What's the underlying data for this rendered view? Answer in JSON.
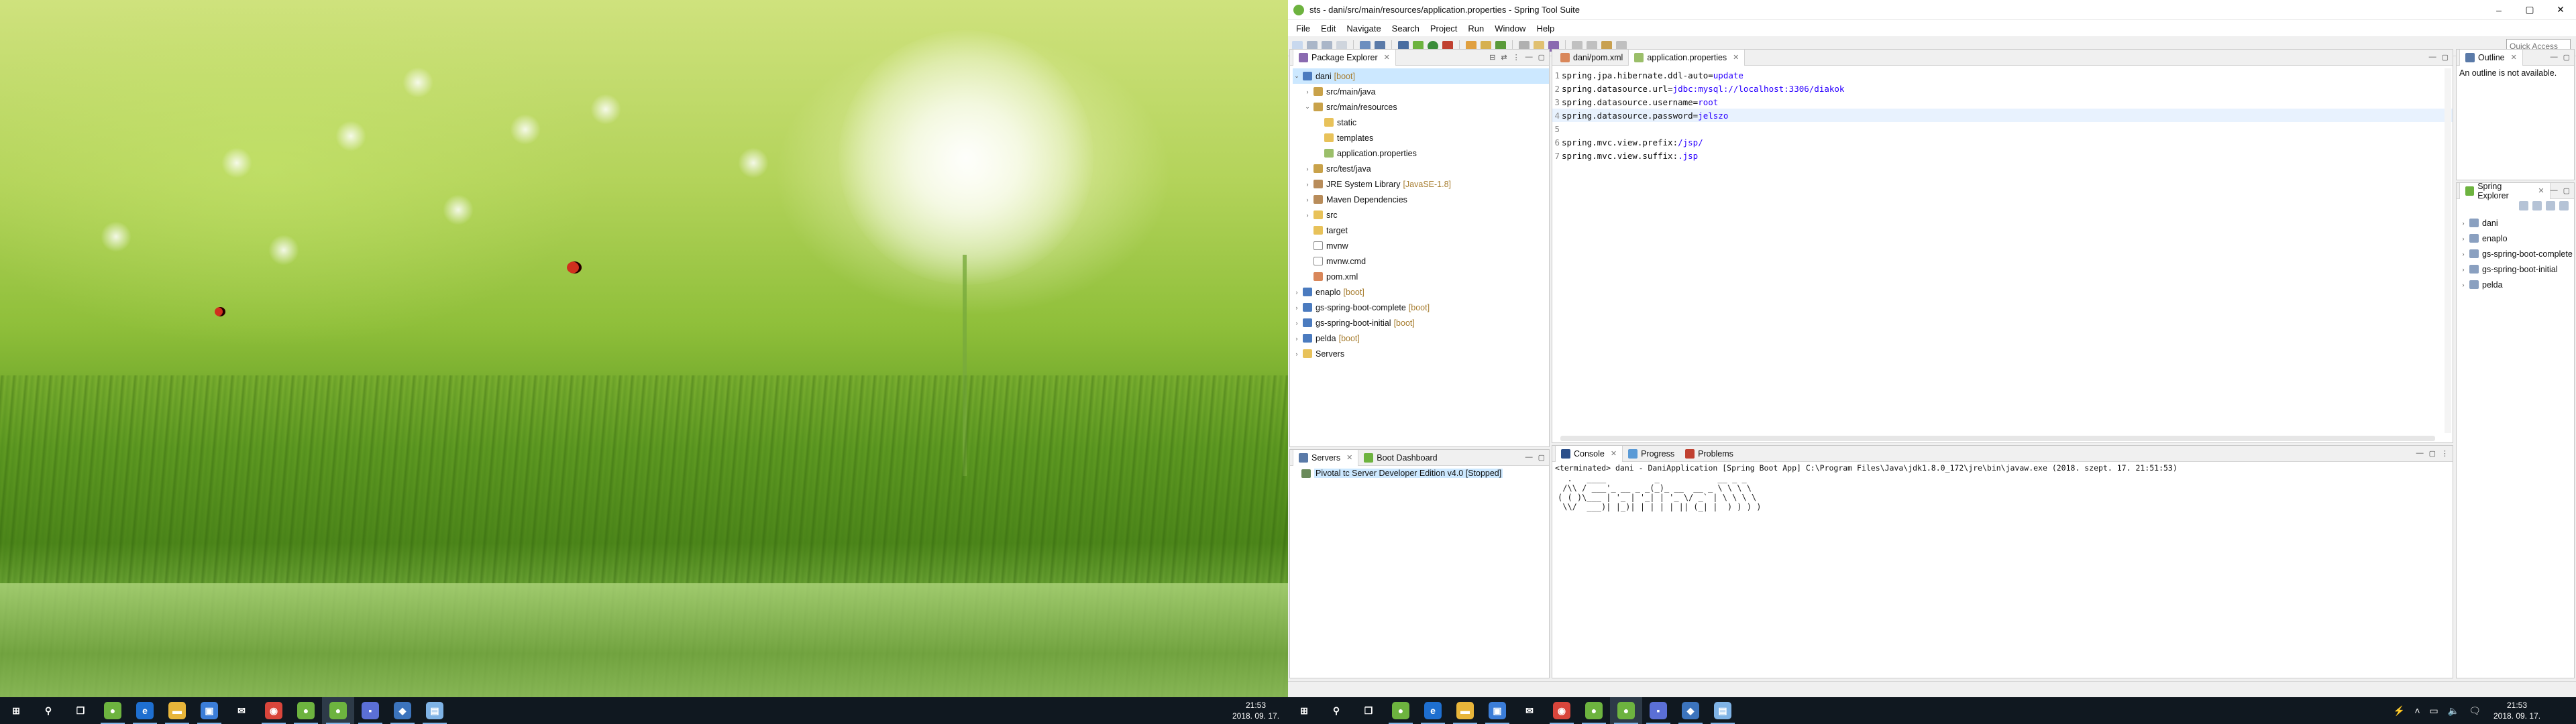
{
  "window": {
    "title": "sts - dani/src/main/resources/application.properties - Spring Tool Suite",
    "controls": [
      "–",
      "▢",
      "✕"
    ]
  },
  "menu": [
    "File",
    "Edit",
    "Navigate",
    "Search",
    "Project",
    "Run",
    "Window",
    "Help"
  ],
  "quick_access": {
    "placeholder": "Quick Access"
  },
  "package_explorer": {
    "tab_label": "Package Explorer",
    "tree": [
      {
        "label": "dani",
        "decor": "[boot]",
        "icon": "project",
        "level": 0,
        "expanded": true,
        "selected": true
      },
      {
        "label": "src/main/java",
        "icon": "pkgfolder",
        "level": 1,
        "expanded": false
      },
      {
        "label": "src/main/resources",
        "icon": "pkgfolder",
        "level": 1,
        "expanded": true
      },
      {
        "label": "static",
        "icon": "folder",
        "level": 2
      },
      {
        "label": "templates",
        "icon": "folder",
        "level": 2
      },
      {
        "label": "application.properties",
        "icon": "props",
        "level": 2
      },
      {
        "label": "src/test/java",
        "icon": "pkgfolder",
        "level": 1,
        "expanded": false
      },
      {
        "label": "JRE System Library",
        "decor": "[JavaSE-1.8]",
        "icon": "lib",
        "level": 1,
        "expanded": false
      },
      {
        "label": "Maven Dependencies",
        "icon": "lib",
        "level": 1,
        "expanded": false
      },
      {
        "label": "src",
        "icon": "folder",
        "level": 1,
        "expanded": false
      },
      {
        "label": "target",
        "icon": "folder",
        "level": 1
      },
      {
        "label": "mvnw",
        "icon": "file",
        "level": 1
      },
      {
        "label": "mvnw.cmd",
        "icon": "file",
        "level": 1
      },
      {
        "label": "pom.xml",
        "icon": "xml",
        "level": 1
      },
      {
        "label": "enaplo",
        "decor": "[boot]",
        "icon": "project",
        "level": 0,
        "expanded": false
      },
      {
        "label": "gs-spring-boot-complete",
        "decor": "[boot]",
        "icon": "project",
        "level": 0,
        "expanded": false
      },
      {
        "label": "gs-spring-boot-initial",
        "decor": "[boot]",
        "icon": "project",
        "level": 0,
        "expanded": false
      },
      {
        "label": "pelda",
        "decor": "[boot]",
        "icon": "project",
        "level": 0,
        "expanded": false
      },
      {
        "label": "Servers",
        "icon": "folder",
        "level": 0,
        "expanded": false
      }
    ]
  },
  "editor": {
    "tabs": [
      {
        "label": "dani/pom.xml",
        "active": false
      },
      {
        "label": "application.properties",
        "active": true
      }
    ],
    "lines": [
      {
        "n": "1",
        "key": "spring.jpa.hibernate.ddl-auto=",
        "value": "update"
      },
      {
        "n": "2",
        "key": "spring.datasource.url=",
        "value": "jdbc:mysql://localhost:3306/diakok"
      },
      {
        "n": "3",
        "key": "spring.datasource.username=",
        "value": "root"
      },
      {
        "n": "4",
        "key": "spring.datasource.password=",
        "value": "jelszo"
      },
      {
        "n": "5",
        "key": "",
        "value": ""
      },
      {
        "n": "6",
        "key": "spring.mvc.view.prefix: ",
        "value": "/jsp/"
      },
      {
        "n": "7",
        "key": "spring.mvc.view.suffix: ",
        "value": ".jsp"
      }
    ]
  },
  "outline": {
    "tab_label": "Outline",
    "message": "An outline is not available."
  },
  "spring_explorer": {
    "tab_label": "Spring Explorer",
    "items": [
      "dani",
      "enaplo",
      "gs-spring-boot-complete",
      "gs-spring-boot-initial",
      "pelda"
    ]
  },
  "servers_view": {
    "tabs": [
      {
        "label": "Servers",
        "active": true
      },
      {
        "label": "Boot Dashboard",
        "active": false
      }
    ],
    "server": "Pivotal tc Server Developer Edition v4.0  [Stopped]"
  },
  "console_view": {
    "tabs": [
      {
        "label": "Console",
        "active": true
      },
      {
        "label": "Progress",
        "active": false
      },
      {
        "label": "Problems",
        "active": false
      }
    ],
    "status": "<terminated> dani - DaniApplication [Spring Boot App] C:\\Program Files\\Java\\jdk1.8.0_172\\jre\\bin\\javaw.exe (2018. szept. 17. 21:51:53)",
    "ascii_art": "  .   ____          _            __ _ _\n /\\\\ / ___'_ __ _ _(_)_ __  __ _ \\ \\ \\ \\\n( ( )\\___ | '_ | '_| | '_ \\/ _` | \\ \\ \\ \\\n \\\\/  ___)| |_)| | | | | || (_| |  ) ) ) )"
  },
  "taskbar": {
    "clock_time": "21:53",
    "clock_date": "2018. 09. 17.",
    "apps": [
      {
        "icon": "start-icon",
        "glyph": "⊞",
        "color": "transparent"
      },
      {
        "icon": "search-icon",
        "glyph": "⚲",
        "color": "transparent"
      },
      {
        "icon": "task-view-icon",
        "glyph": "❐",
        "color": "transparent"
      },
      {
        "icon": "spring-icon",
        "glyph": "●",
        "color": "#6db33f"
      },
      {
        "icon": "edge-icon",
        "glyph": "e",
        "color": "#1e6fd0"
      },
      {
        "icon": "explorer-icon",
        "glyph": "▬",
        "color": "#e8b53a"
      },
      {
        "icon": "store-icon",
        "glyph": "▣",
        "color": "#3b7dd8"
      },
      {
        "icon": "mail-icon",
        "glyph": "✉",
        "color": "transparent"
      },
      {
        "icon": "chrome-icon",
        "glyph": "◉",
        "color": "#d9453b"
      },
      {
        "icon": "spring-tool-icon",
        "glyph": "●",
        "color": "#6db33f"
      },
      {
        "icon": "spring-tool-active-icon",
        "glyph": "●",
        "color": "#6db33f"
      },
      {
        "icon": "save-disk-icon",
        "glyph": "▪",
        "color": "#5b6fd6"
      },
      {
        "icon": "vs-icon",
        "glyph": "◆",
        "color": "#3c74bd"
      },
      {
        "icon": "notepad-icon",
        "glyph": "▤",
        "color": "#7fb3e6"
      }
    ],
    "tray": [
      "⚡",
      "˄",
      "▭",
      "🔈",
      "🗨"
    ]
  }
}
